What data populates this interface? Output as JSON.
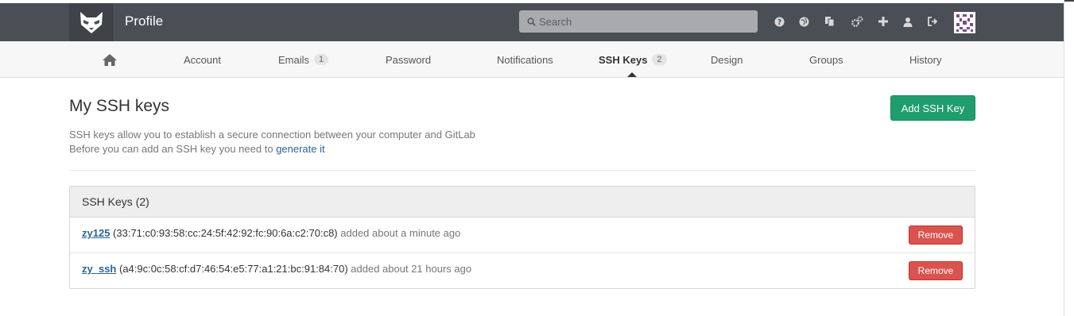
{
  "header": {
    "title": "Profile",
    "search_placeholder": "Search",
    "icons": [
      "help-icon",
      "globe-icon",
      "copy-icon",
      "cogs-icon",
      "plus-icon",
      "user-icon",
      "sign-out-icon"
    ]
  },
  "subnav": {
    "items": [
      {
        "label": "",
        "icon": "home-icon"
      },
      {
        "label": "Account"
      },
      {
        "label": "Emails",
        "badge": "1"
      },
      {
        "label": "Password"
      },
      {
        "label": "Notifications"
      },
      {
        "label": "SSH Keys",
        "badge": "2",
        "active": true
      },
      {
        "label": "Design"
      },
      {
        "label": "Groups"
      },
      {
        "label": "History"
      }
    ]
  },
  "main": {
    "title": "My SSH keys",
    "add_button": "Add SSH Key",
    "desc_line1": "SSH keys allow you to establish a secure connection between your computer and GitLab",
    "desc_line2_prefix": "Before you can add an SSH key you need to",
    "desc_link": "generate it"
  },
  "panel": {
    "heading": "SSH Keys (2)",
    "keys": [
      {
        "name": "zy125",
        "fingerprint": "(33:71:c0:93:58:cc:24:5f:42:92:fc:90:6a:c2:70:c8)",
        "added": "added about a minute ago",
        "remove": "Remove"
      },
      {
        "name": "zy_ssh",
        "fingerprint": "(a4:9c:0c:58:cf:d7:46:54:e5:77:a1:21:bc:91:84:70)",
        "added": "added about 21 hours ago",
        "remove": "Remove"
      }
    ]
  },
  "colors": {
    "header_bg": "#4a4e55",
    "add_button": "#1f9d6f",
    "remove_button": "#d9534f",
    "link": "#2a6496"
  }
}
